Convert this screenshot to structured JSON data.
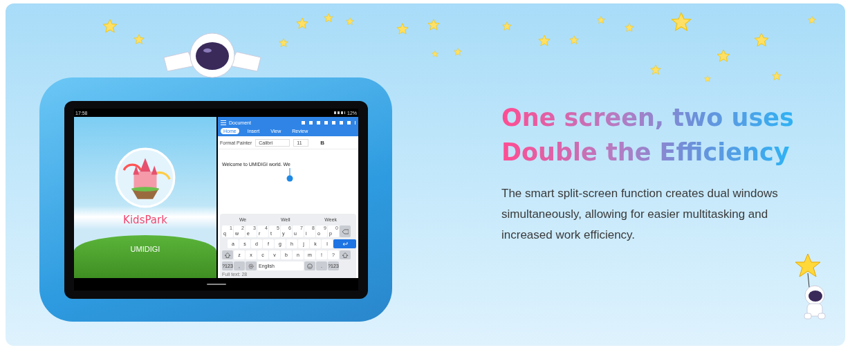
{
  "tablet": {
    "status_bar": {
      "time": "17:58",
      "battery": "12%"
    },
    "left_app": {
      "app_name": "KidsPark",
      "brand": "UMIDIGI"
    },
    "document_app": {
      "title": "Document",
      "tabs": [
        {
          "label": "Home",
          "selected": true
        },
        {
          "label": "Insert",
          "selected": false
        },
        {
          "label": "View",
          "selected": false
        },
        {
          "label": "Review",
          "selected": false
        }
      ],
      "toolbar": {
        "format_painter": "Format Painter",
        "font": "Calibri",
        "font_size": "11",
        "bold": "B"
      },
      "text": "Welcome to UMIDIGI world. We",
      "keyboard": {
        "suggestions": [
          "We",
          "Well",
          "Week"
        ],
        "rows": [
          [
            {
              "kind": "letter",
              "label": "q",
              "hint": "1"
            },
            {
              "kind": "letter",
              "label": "w",
              "hint": "2"
            },
            {
              "kind": "letter",
              "label": "e",
              "hint": "3"
            },
            {
              "kind": "letter",
              "label": "r",
              "hint": "4"
            },
            {
              "kind": "letter",
              "label": "t",
              "hint": "5"
            },
            {
              "kind": "letter",
              "label": "y",
              "hint": "6"
            },
            {
              "kind": "letter",
              "label": "u",
              "hint": "7"
            },
            {
              "kind": "letter",
              "label": "i",
              "hint": "8"
            },
            {
              "kind": "letter",
              "label": "o",
              "hint": "9"
            },
            {
              "kind": "letter",
              "label": "p",
              "hint": "0"
            },
            {
              "kind": "backspace"
            }
          ],
          [
            {
              "kind": "letter",
              "label": "a"
            },
            {
              "kind": "letter",
              "label": "s"
            },
            {
              "kind": "letter",
              "label": "d"
            },
            {
              "kind": "letter",
              "label": "f"
            },
            {
              "kind": "letter",
              "label": "g"
            },
            {
              "kind": "letter",
              "label": "h"
            },
            {
              "kind": "letter",
              "label": "j"
            },
            {
              "kind": "letter",
              "label": "k"
            },
            {
              "kind": "letter",
              "label": "l"
            },
            {
              "kind": "enter"
            }
          ],
          [
            {
              "kind": "shift"
            },
            {
              "kind": "letter",
              "label": "z"
            },
            {
              "kind": "letter",
              "label": "x"
            },
            {
              "kind": "letter",
              "label": "c"
            },
            {
              "kind": "letter",
              "label": "v"
            },
            {
              "kind": "letter",
              "label": "b"
            },
            {
              "kind": "letter",
              "label": "n"
            },
            {
              "kind": "letter",
              "label": "m"
            },
            {
              "kind": "letter",
              "label": "!"
            },
            {
              "kind": "letter",
              "label": "?"
            },
            {
              "kind": "shift"
            }
          ]
        ],
        "bottom_row": [
          {
            "kind": "function",
            "label": "?123"
          },
          {
            "kind": "function",
            "label": ","
          },
          {
            "kind": "settings"
          },
          {
            "kind": "space",
            "label": "English"
          },
          {
            "kind": "emoji"
          },
          {
            "kind": "function",
            "label": "."
          },
          {
            "kind": "function",
            "label": "?123"
          }
        ]
      },
      "footer": "Full text: 28"
    }
  },
  "heading": {
    "line_1": "One screen, two uses",
    "line_2": "Double the Efficiency"
  },
  "description": "The smart split-screen function creates dual windows simultaneously, allowing for easier multitasking and increased work efficiency."
}
